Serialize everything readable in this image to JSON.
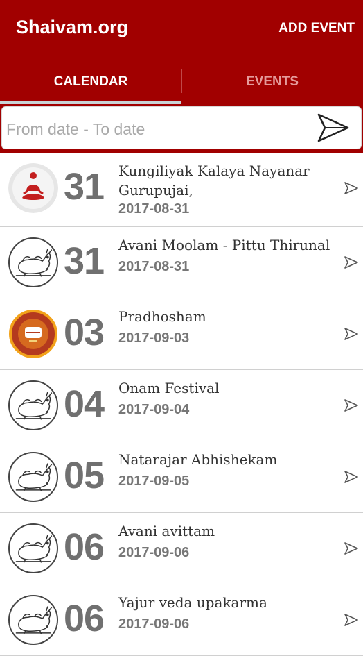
{
  "app": {
    "title": "Shaivam.org",
    "add_event_label": "ADD EVENT"
  },
  "tabs": [
    {
      "label": "CALENDAR",
      "active": true
    },
    {
      "label": "EVENTS",
      "active": false
    }
  ],
  "search": {
    "placeholder": "From date  -  To date"
  },
  "colors": {
    "primary": "#a10000",
    "tab_inactive": "#e59a9a",
    "day_number": "#707070"
  },
  "events": [
    {
      "day": "31",
      "title": "Kungiliyak Kalaya Nayanar Gurupujai,",
      "date": "2017-08-31",
      "icon": "meditating-figure-icon"
    },
    {
      "day": "31",
      "title": "Avani Moolam - Pittu Thirunal",
      "date": "2017-08-31",
      "icon": "nandi-icon"
    },
    {
      "day": "03",
      "title": "Pradhosham",
      "date": "2017-09-03",
      "icon": "pradhosham-emblem-icon"
    },
    {
      "day": "04",
      "title": "Onam Festival",
      "date": "2017-09-04",
      "icon": "nandi-icon"
    },
    {
      "day": "05",
      "title": "Natarajar Abhishekam",
      "date": "2017-09-05",
      "icon": "nandi-icon"
    },
    {
      "day": "06",
      "title": "Avani avittam",
      "date": "2017-09-06",
      "icon": "nandi-icon"
    },
    {
      "day": "06",
      "title": "Yajur veda upakarma",
      "date": "2017-09-06",
      "icon": "nandi-icon"
    }
  ]
}
